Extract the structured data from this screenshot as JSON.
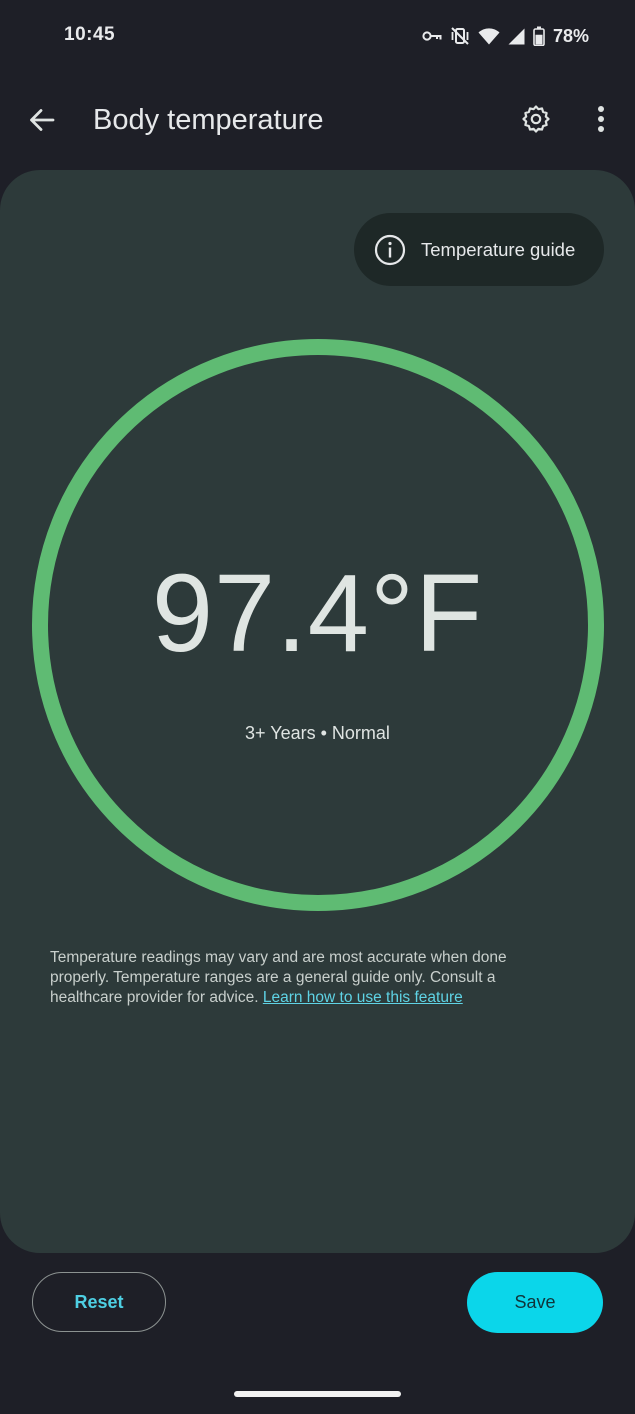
{
  "status_bar": {
    "time": "10:45",
    "battery_percent": "78%",
    "battery_level": 0.78,
    "icons": [
      "vpn-key-icon",
      "vibrate-off-icon",
      "wifi-icon",
      "cellular-signal-icon",
      "battery-icon"
    ]
  },
  "app_bar": {
    "title": "Body temperature",
    "back_icon": "arrow-back-icon",
    "settings_icon": "gear-icon",
    "more_icon": "more-vert-icon"
  },
  "guide_button": {
    "label": "Temperature guide",
    "icon": "info-icon"
  },
  "reading": {
    "value": "97.4°F",
    "status": "3+ Years • Normal",
    "ring_color": "#5fbb73"
  },
  "disclaimer": {
    "text": "Temperature readings may vary and are most accurate when done properly. Temperature ranges are a general guide only. Consult a healthcare provider for advice.",
    "link": "Learn how to use this feature"
  },
  "actions": {
    "reset_label": "Reset",
    "save_label": "Save"
  },
  "colors": {
    "background": "#1e1f27",
    "card": "#2d3a3a",
    "accent": "#0bd6ea",
    "link": "#5fd3e5"
  }
}
